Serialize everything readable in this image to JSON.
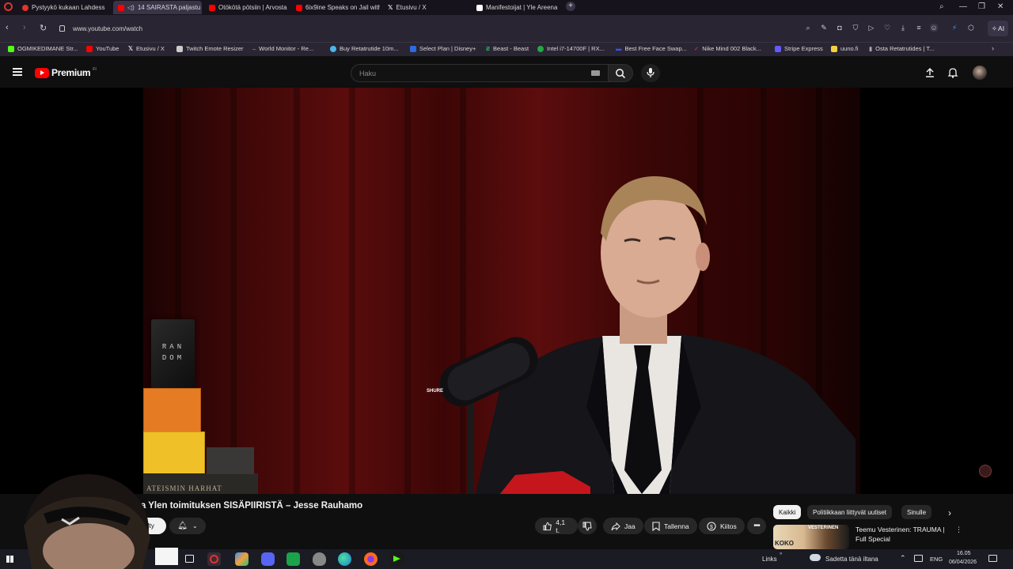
{
  "browser": {
    "tabs": [
      {
        "label": "Pystyykö kukaan Lahdess",
        "color": "#e0342d",
        "active": false
      },
      {
        "label": "14 SAIRASTA paljastu",
        "color": "#ff0000",
        "active": true
      },
      {
        "label": "Otökötä pötsiin | Arvosta",
        "color": "#ff0000",
        "active": false
      },
      {
        "label": "6ix9ine Speaks on Jail with",
        "color": "#ff0000",
        "active": false
      },
      {
        "label": "Etusivu / X",
        "color": "#ffffff",
        "active": false
      },
      {
        "label": "Manifestoijat | Yle Areena",
        "color": "#ffffff",
        "active": false
      }
    ],
    "url": "www.youtube.com/watch",
    "ai_label": "AI",
    "bookmarks": [
      {
        "label": "OGMIKEDIMANE Str...",
        "color": "#53fc18"
      },
      {
        "label": "YouTube",
        "color": "#ff0000"
      },
      {
        "label": "Etusivu / X",
        "color": "#ffffff"
      },
      {
        "label": "Twitch Emote Resizer",
        "color": "#cccccc"
      },
      {
        "label": "World Monitor - Re...",
        "color": "#aaaaaa"
      },
      {
        "label": "Buy Retatrutide 10m...",
        "color": "#4db6e8"
      },
      {
        "label": "Select Plan | Disney+",
        "color": "#2d6ae3"
      },
      {
        "label": "Beast - Beast",
        "color": "#2ecc71"
      },
      {
        "label": "Intel i7-14700F | RX...",
        "color": "#22aa44"
      },
      {
        "label": "Best Free Face Swap...",
        "color": "#3355ff"
      },
      {
        "label": "Nike Mind 002 Black...",
        "color": "#e24444"
      },
      {
        "label": "Stripe Express",
        "color": "#635bff"
      },
      {
        "label": "uuno.fi",
        "color": "#f4d03f"
      },
      {
        "label": "Osta Retatrutides | T...",
        "color": "#888888"
      }
    ]
  },
  "youtube": {
    "logo_text": "Premium",
    "logo_sup": "FI",
    "search_placeholder": "Haku"
  },
  "video": {
    "title": "ta Ylen toimituksen SISÄPIIRISTÄ – Jesse Rauhamo",
    "subscribe_label": "ilty",
    "like_count": "4,1 t.",
    "share_label": "Jaa",
    "save_label": "Tallenna",
    "thanks_label": "Kiitos",
    "box_top_text": "RAN DOM",
    "box_bottom_text": "ATEISMIN HARHAT",
    "mic_brand": "SHURE"
  },
  "recommend": {
    "chips": [
      "Kaikki",
      "Politiikkaan liittyvät uutiset",
      "Sinulle"
    ],
    "first_title": "Teemu Vesterinen: TRAUMA | Full Special",
    "thumb_text_top": "VESTERINEN",
    "thumb_text_bottom": "KOKO"
  },
  "taskbar": {
    "links_label": "Links",
    "weather": "Sadetta tänä iltana",
    "lang": "ENG",
    "time": "16.05",
    "date": "06/04/2026"
  }
}
